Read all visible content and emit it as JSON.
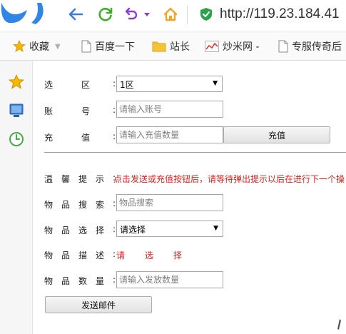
{
  "browser": {
    "url": "http://119.23.184.41",
    "icons": [
      "browser-logo",
      "back-icon",
      "refresh-icon",
      "undo-icon",
      "home-icon",
      "shield-icon"
    ]
  },
  "bookmarks": {
    "favorites_label": "收藏",
    "items": [
      {
        "label": "百度一下",
        "icon": "page-icon"
      },
      {
        "label": "站长",
        "icon": "folder-icon"
      },
      {
        "label": "炒米网 -",
        "icon": "chart-icon"
      },
      {
        "label": "专服传奇后",
        "icon": "page-icon"
      }
    ]
  },
  "sidebar": {
    "icons": [
      "star-icon",
      "screen-icon",
      "clock-icon"
    ]
  },
  "form": {
    "region": {
      "label": "选区",
      "value": "1区"
    },
    "account": {
      "label": "账号",
      "placeholder": "请输入账号"
    },
    "recharge": {
      "label": "充值",
      "placeholder": "请输入充值数量",
      "button": "充值"
    },
    "tip": {
      "label": "温馨提示",
      "text": "点击发送或充值按钮后，请等待弹出提示以后在进行下一个操"
    },
    "item_search": {
      "label": "物品搜索",
      "placeholder": "物品搜索"
    },
    "item_select": {
      "label": "物品选择",
      "value": "请选择"
    },
    "item_desc": {
      "label": "物品描述",
      "text": "请选择"
    },
    "item_qty": {
      "label": "物品数量",
      "placeholder": "请输入发放数量"
    },
    "send_button": "发送邮件"
  },
  "colors": {
    "warning_red": "#e0201c",
    "back_blue": "#3a7fd5",
    "refresh_green": "#3fae29",
    "undo_purple": "#8a3fd1",
    "home_orange": "#f2a623",
    "shield_green": "#2ea24a",
    "star_yellow": "#f5b700"
  }
}
